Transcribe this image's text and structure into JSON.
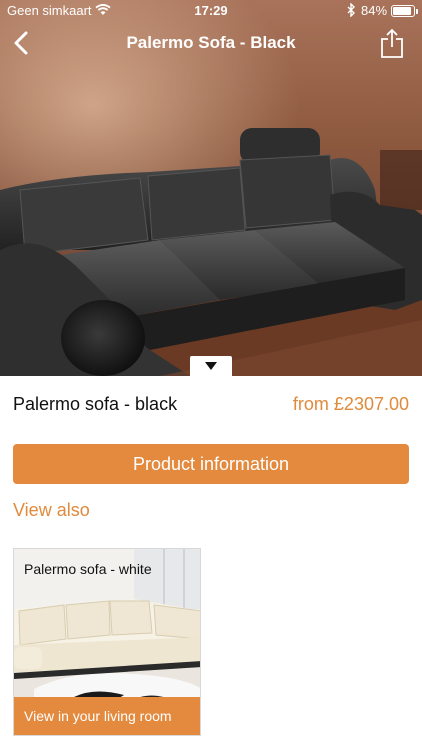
{
  "status_bar": {
    "carrier": "Geen simkaart",
    "time": "17:29",
    "battery": "84%",
    "battery_level": 0.84
  },
  "nav": {
    "title": "Palermo Sofa - Black",
    "back_icon": "chevron-left-icon",
    "share_icon": "share-icon"
  },
  "hero": {
    "collapse_icon": "triangle-down-icon"
  },
  "product": {
    "name": "Palermo sofa - black",
    "price": "from £2307.00"
  },
  "buttons": {
    "product_info": "Product information"
  },
  "section": {
    "view_also": "View also"
  },
  "related": [
    {
      "title": "Palermo sofa - white",
      "action": "View in your living room"
    }
  ],
  "colors": {
    "accent": "#e38a3e",
    "accent_text": "#e08a3c"
  }
}
